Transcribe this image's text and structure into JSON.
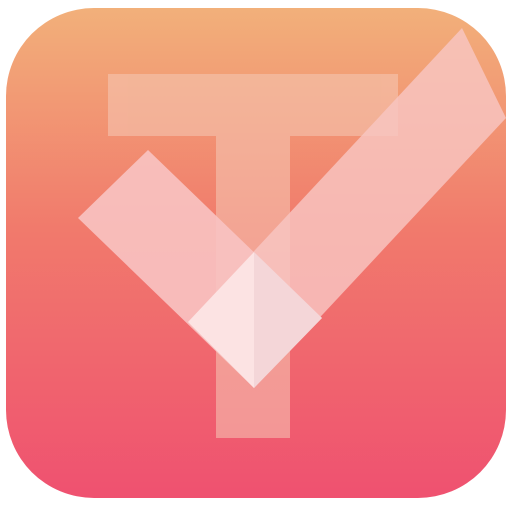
{
  "icon": {
    "name": "checkmark-t-logo",
    "colors": {
      "gradient_top": "#F2B07A",
      "gradient_mid": "#F17A6C",
      "gradient_bottom": "#EF5170",
      "letter_t": "#F5C9B6",
      "check_left": "#F8C3C2",
      "check_right": "#F8C6C2",
      "check_joint_light": "#FCE3E3",
      "check_joint_shade": "#F4D6D8",
      "background": "#FFFFFF"
    }
  }
}
